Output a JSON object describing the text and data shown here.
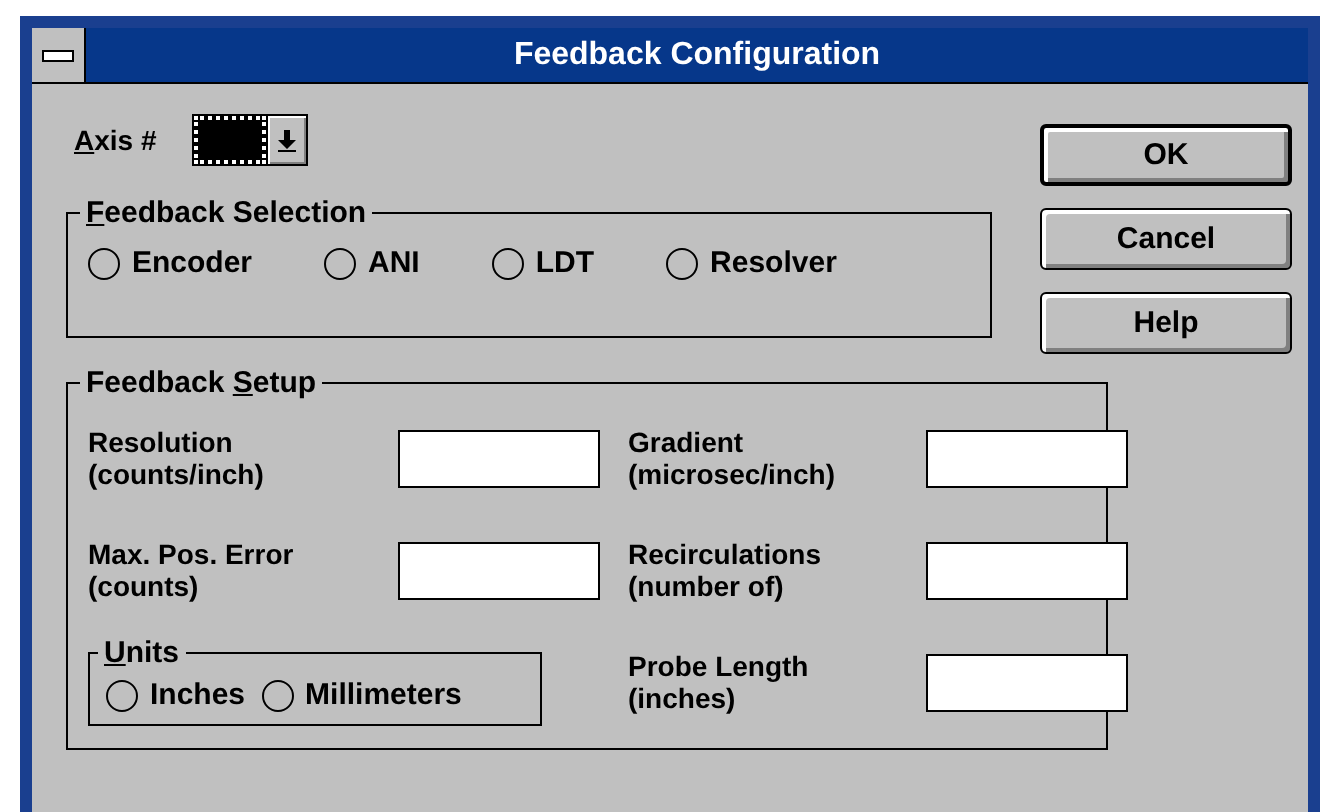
{
  "window": {
    "title": "Feedback Configuration"
  },
  "axis": {
    "access_key": "A",
    "label_after": "xis #"
  },
  "buttons": [
    {
      "label": "OK",
      "default": true
    },
    {
      "label": "Cancel",
      "default": false
    },
    {
      "label": "Help",
      "default": false
    }
  ],
  "feedback_selection": {
    "access_key": "F",
    "title_after": "eedback Selection",
    "options": [
      {
        "label": "Encoder",
        "selected": false
      },
      {
        "label": "ANI",
        "selected": false
      },
      {
        "label": "LDT",
        "selected": false
      },
      {
        "label": "Resolver",
        "selected": false
      }
    ]
  },
  "feedback_setup": {
    "title_before": "Feedback ",
    "access_key": "S",
    "title_after": "etup",
    "left_fields": [
      {
        "label": "Resolution",
        "sublabel": "(counts/inch)"
      },
      {
        "label": "Max. Pos. Error",
        "sublabel": "(counts)"
      }
    ],
    "right_fields": [
      {
        "label": "Gradient",
        "sublabel": "(microsec/inch)"
      },
      {
        "label": "Recirculations",
        "sublabel": "(number of)"
      },
      {
        "label": "Probe Length",
        "sublabel": "(inches)"
      }
    ],
    "units": {
      "access_key": "U",
      "title_after": "nits",
      "options": [
        {
          "label": "Inches",
          "selected": false
        },
        {
          "label": "Millimeters",
          "selected": false
        }
      ]
    }
  }
}
